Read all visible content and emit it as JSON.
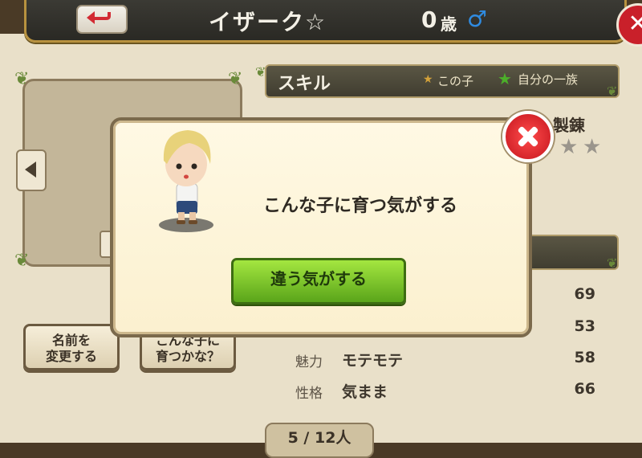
{
  "header": {
    "name": "イザーク☆",
    "age": "0",
    "age_unit": "歳",
    "gender": "♂"
  },
  "skills": {
    "title": "スキル",
    "legend_this_child": "この子",
    "legend_family": "自分の一族",
    "refine_label": "製錬"
  },
  "stats": [
    {
      "label": "",
      "value": "",
      "number": "69"
    },
    {
      "label": "",
      "value": "",
      "number": "53"
    },
    {
      "label": "魅力",
      "value": "モテモテ",
      "number": "58"
    },
    {
      "label": "性格",
      "value": "気まま",
      "number": "66"
    }
  ],
  "buttons": {
    "rename": "名前を\n変更する",
    "grow": "こんな子に\n育つかな？"
  },
  "pager": {
    "current": "5",
    "total": "12人"
  },
  "dialog": {
    "message": "こんな子に育つ気がする",
    "deny_button": "違う気がする"
  },
  "colors": {
    "accent_red": "#c9202a",
    "button_green": "#6fc222",
    "gender_blue": "#2f8be0"
  },
  "icons": {
    "back": "back-arrow-icon",
    "close": "close-icon",
    "star": "star-icon",
    "leaf": "leaf-icon"
  }
}
